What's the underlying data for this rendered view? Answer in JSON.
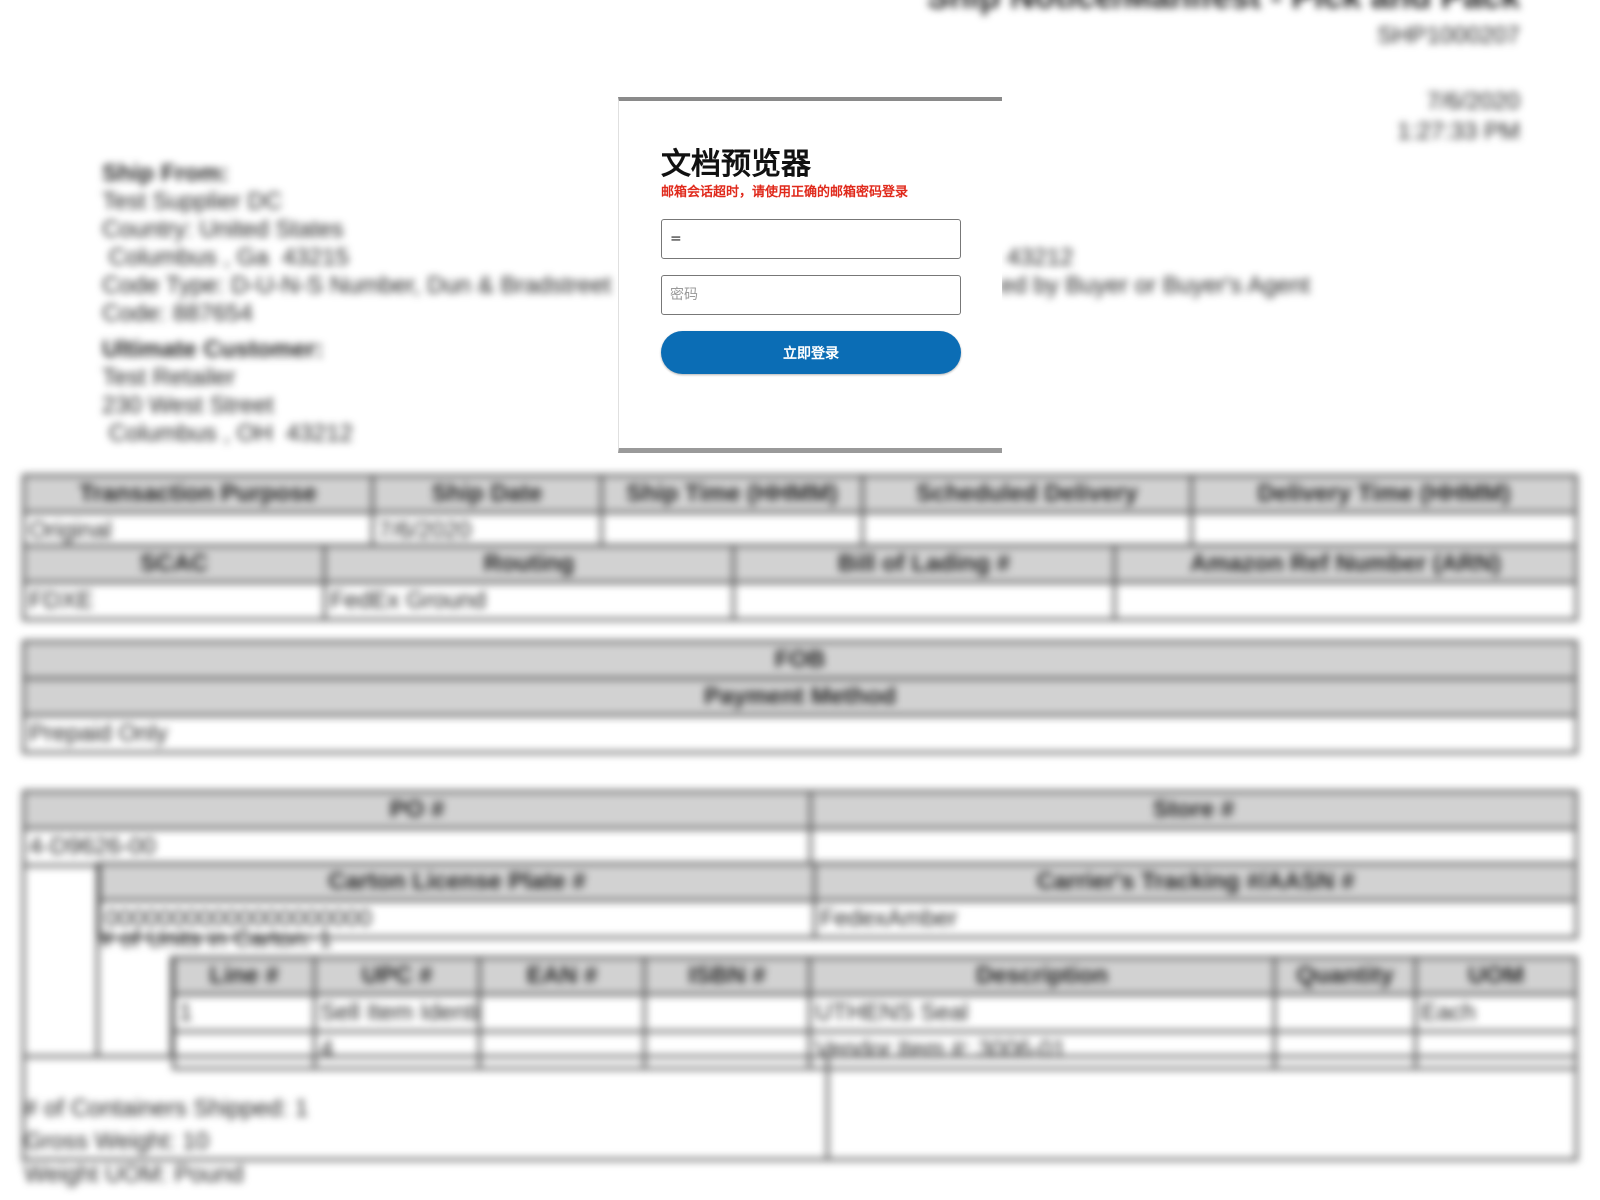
{
  "document": {
    "title": "Ship Notice/Manifest - Pick and Pack",
    "ref": "SHP1000207",
    "date": "7/6/2020",
    "time": "1:27:33 PM",
    "ship_from": {
      "heading": "Ship From:",
      "lines": [
        "Test Supplier DC",
        "Country: United States",
        " Columbus , Ga  43215",
        "Code Type: D-U-N-S Number, Dun & Bradstreet",
        "Code: 887654"
      ]
    },
    "ship_from_right": [
      " 43212",
      "ed by Buyer or Buyer's Agent"
    ],
    "ultimate_customer": {
      "heading": "Ultimate Customer:",
      "lines": [
        "Test Retailer",
        "230 West Street",
        " Columbus , OH  43212"
      ]
    },
    "table1": {
      "headers_row1": [
        "Transaction Purpose",
        "Ship Date",
        "Ship Time (HHMM)",
        "Scheduled Delivery",
        "Delivery Time (HHMM)"
      ],
      "values_row1": [
        "Original",
        "7/6/2020",
        "",
        "",
        ""
      ],
      "headers_row2": [
        "SCAC",
        "Routing",
        "Bill of Lading #",
        "Amazon Ref Number (ARN)"
      ],
      "values_row2": [
        "FDXE",
        "FedEx Ground",
        "",
        ""
      ]
    },
    "table2": {
      "header1": "FOB",
      "header2": "Payment Method",
      "value": "Prepaid Only"
    },
    "table3": {
      "po_header": "PO #",
      "store_header": "Store #",
      "po_value": "4-D9626-00",
      "carton_header": "Carton License Plate #",
      "tracking_header": "Carrier's Tracking #/AASN #",
      "carton_value": "00000000000000000000",
      "tracking_value": "FedexAmber",
      "units": "# of Units in Carton: 1",
      "item_headers": [
        "Line #",
        "UPC #",
        "EAN #",
        "ISBN #",
        "Description",
        "Quantity",
        "UOM"
      ],
      "item_row": [
        "1",
        "Sell Item Identi",
        "",
        "",
        "UTHENS Seal",
        "",
        "Each"
      ],
      "item_row2": [
        "",
        "4",
        "",
        "",
        "Vendor Item #: 3006-01",
        "",
        ""
      ],
      "containers": "# of Containers Shipped: 1",
      "gross_weight": "Gross Weight: 10",
      "weight_uom": "Weight UOM: Pound"
    }
  },
  "modal": {
    "title": "文档预览器",
    "message": "邮箱会话超时，请使用正确的邮箱密码登录",
    "email_value": "=",
    "password_placeholder": "密码",
    "login_label": "立即登录"
  },
  "colors": {
    "accent_button": "#0b6db5",
    "error_text": "#e0291b",
    "table_header": "#d2d2d2"
  }
}
